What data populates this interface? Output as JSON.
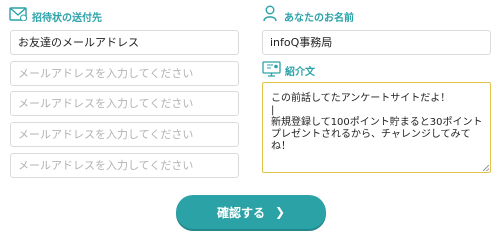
{
  "invite": {
    "label": "招待状の送付先",
    "icon": "envelope-icon",
    "first_value": "お友達のメールアドレス",
    "placeholder": "メールアドレスを入力してください"
  },
  "name": {
    "label": "あなたのお名前",
    "icon": "person-icon",
    "value": "infoQ事務局"
  },
  "intro": {
    "label": "紹介文",
    "icon": "monitor-chat-icon",
    "text": "この前話してたアンケートサイトだよ！\n|\n新規登録して100ポイント貯まると30ポイントプレゼントされるから、チャレンジしてみてね！"
  },
  "confirm": {
    "label": "確認する",
    "icon": "chevron-right-icon"
  },
  "colors": {
    "accent": "#2aa3a9",
    "button": "#2ba2a6",
    "textarea_border": "#e2c24a"
  }
}
